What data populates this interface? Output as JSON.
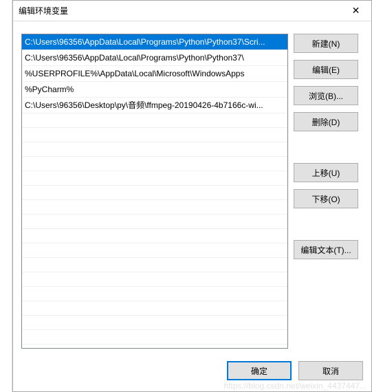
{
  "dialog": {
    "title": "编辑环境变量"
  },
  "list": {
    "items": [
      {
        "text": "C:\\Users\\96356\\AppData\\Local\\Programs\\Python\\Python37\\Scri...",
        "selected": true
      },
      {
        "text": "C:\\Users\\96356\\AppData\\Local\\Programs\\Python\\Python37\\",
        "selected": false
      },
      {
        "text": "%USERPROFILE%\\AppData\\Local\\Microsoft\\WindowsApps",
        "selected": false
      },
      {
        "text": "%PyCharm%",
        "selected": false
      },
      {
        "text": "C:\\Users\\96356\\Desktop\\py\\音频\\ffmpeg-20190426-4b7166c-wi...",
        "selected": false
      }
    ]
  },
  "buttons": {
    "new": "新建(N)",
    "edit": "编辑(E)",
    "browse": "浏览(B)...",
    "delete": "删除(D)",
    "moveup": "上移(U)",
    "movedown": "下移(O)",
    "edittext": "编辑文本(T)...",
    "ok": "确定",
    "cancel": "取消"
  },
  "watermark": "https://blog.csdn.net/weixin_4437447..."
}
